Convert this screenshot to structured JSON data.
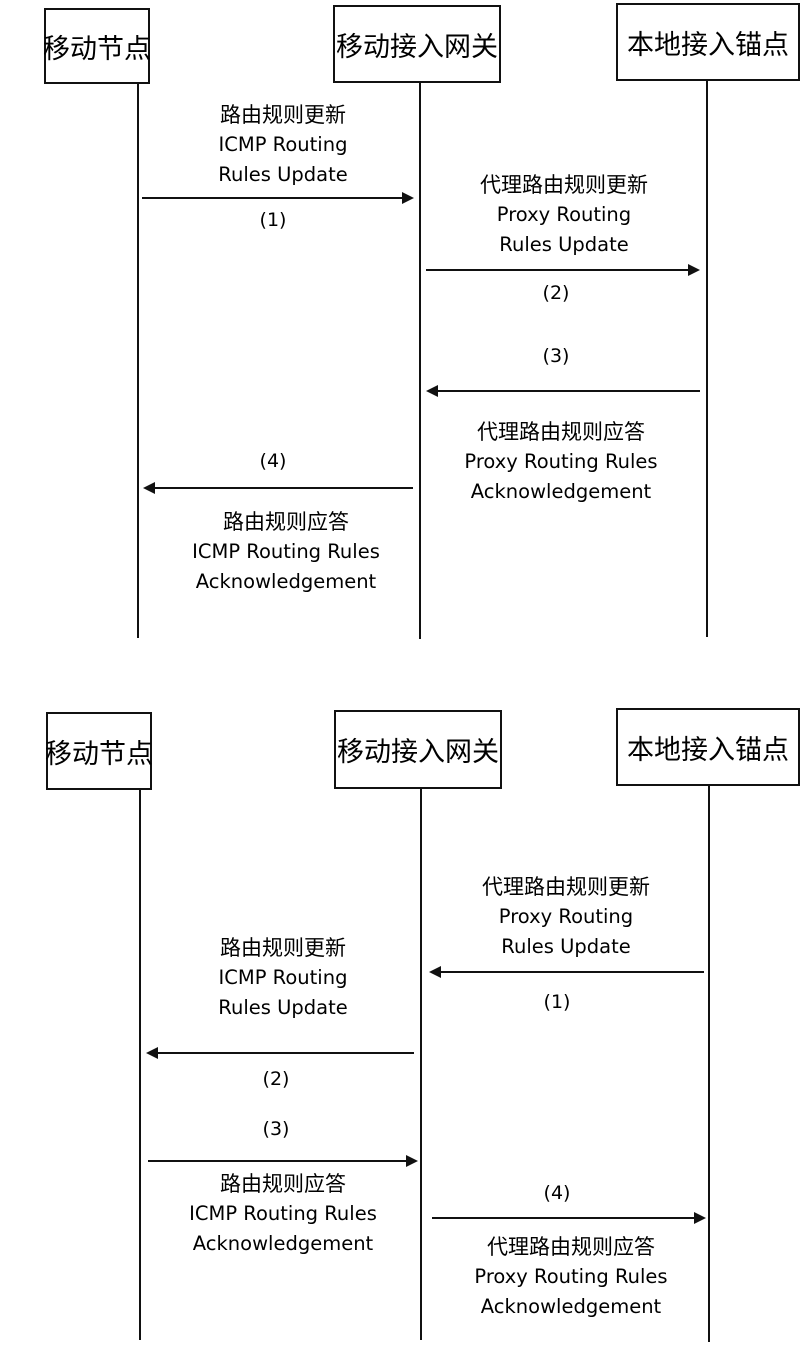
{
  "diagrams": [
    {
      "participants": [
        {
          "id": "mn",
          "label": "移动节点"
        },
        {
          "id": "mag",
          "label": "移动接入网关"
        },
        {
          "id": "lma",
          "label": "本地接入锚点"
        }
      ],
      "messages": [
        {
          "step": "(1)",
          "from": "mn",
          "to": "mag",
          "cn": "路由规则更新",
          "en1": "ICMP Routing",
          "en2": "Rules Update"
        },
        {
          "step": "(2)",
          "from": "mag",
          "to": "lma",
          "cn": "代理路由规则更新",
          "en1": "Proxy Routing",
          "en2": "Rules Update"
        },
        {
          "step": "(3)",
          "from": "lma",
          "to": "mag",
          "cn": "代理路由规则应答",
          "en1": "Proxy Routing Rules",
          "en2": "Acknowledgement"
        },
        {
          "step": "(4)",
          "from": "mag",
          "to": "mn",
          "cn": "路由规则应答",
          "en1": "ICMP Routing Rules",
          "en2": "Acknowledgement"
        }
      ]
    },
    {
      "participants": [
        {
          "id": "mn",
          "label": "移动节点"
        },
        {
          "id": "mag",
          "label": "移动接入网关"
        },
        {
          "id": "lma",
          "label": "本地接入锚点"
        }
      ],
      "messages": [
        {
          "step": "(1)",
          "from": "lma",
          "to": "mag",
          "cn": "代理路由规则更新",
          "en1": "Proxy Routing",
          "en2": "Rules Update"
        },
        {
          "step": "(2)",
          "from": "mag",
          "to": "mn",
          "cn": "路由规则更新",
          "en1": "ICMP Routing",
          "en2": "Rules Update"
        },
        {
          "step": "(3)",
          "from": "mn",
          "to": "mag",
          "cn": "路由规则应答",
          "en1": "ICMP Routing Rules",
          "en2": "Acknowledgement"
        },
        {
          "step": "(4)",
          "from": "mag",
          "to": "lma",
          "cn": "代理路由规则应答",
          "en1": "Proxy Routing Rules",
          "en2": "Acknowledgement"
        }
      ]
    }
  ]
}
